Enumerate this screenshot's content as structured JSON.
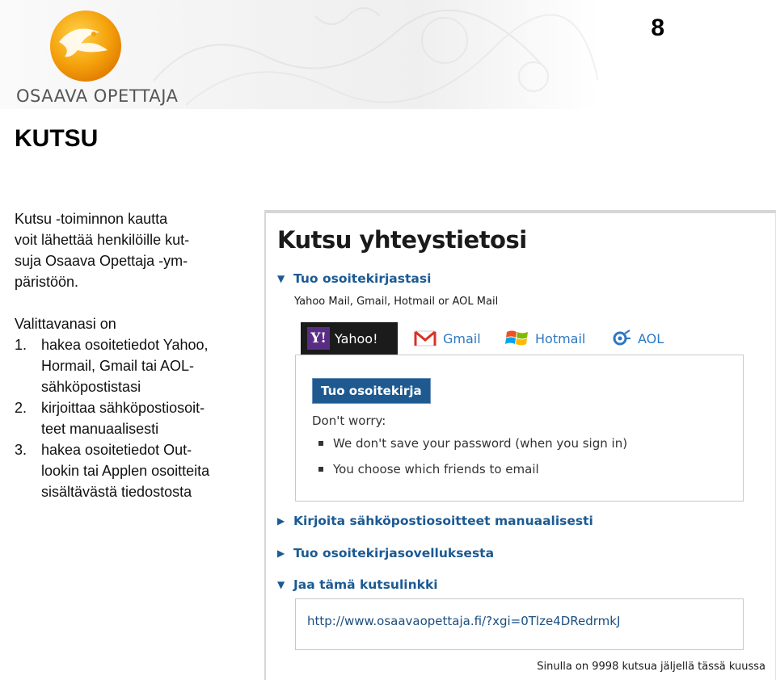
{
  "page_number": "8",
  "logo": {
    "text": "OSAAVA OPETTAJA"
  },
  "title": "KUTSU",
  "intro": {
    "lines": [
      "Kutsu -toiminnon kautta",
      "voit lähettää henkilöille kut-",
      "suja Osaava Opettaja -ym-",
      "päristöön."
    ],
    "choices_intro": "Valittavanasi on",
    "choices": [
      {
        "num": "1.",
        "lines": [
          "hakea osoitetiedot Yahoo,",
          "Hormail, Gmail tai AOL-",
          "sähköpostistasi"
        ]
      },
      {
        "num": "2.",
        "lines": [
          "kirjoittaa sähköpostiosoit-",
          "teet manuaalisesti"
        ]
      },
      {
        "num": "3.",
        "lines": [
          "hakea osoitetiedot Out-",
          "lookin tai Applen osoitteita",
          "sisältävästä tiedostosta"
        ]
      }
    ]
  },
  "screenshot": {
    "title": "Kutsu yhteystietosi",
    "sections": {
      "import": {
        "label": "Tuo osoitekirjastasi",
        "expanded_marker": "▼"
      },
      "manual": {
        "label": "Kirjoita sähköpostiosoitteet manuaalisesti",
        "collapsed_marker": "▶"
      },
      "apps": {
        "label": "Tuo osoitekirjasovelluksesta",
        "collapsed_marker": "▶"
      },
      "share": {
        "label": "Jaa tämä kutsulinkki",
        "expanded_marker": "▼"
      }
    },
    "providers_caption": "Yahoo Mail, Gmail, Hotmail or AOL Mail",
    "providers": [
      {
        "name": "Yahoo!",
        "icon": "yahoo-icon",
        "selected": true
      },
      {
        "name": "Gmail",
        "icon": "gmail-icon"
      },
      {
        "name": "Hotmail",
        "icon": "windows-flag-icon"
      },
      {
        "name": "AOL",
        "icon": "aol-icon"
      }
    ],
    "import_button": "Tuo osoitekirja",
    "dont_worry": "Don't worry:",
    "bullets": [
      "We don't save your password (when you sign in)",
      "You choose which friends to email"
    ],
    "invite_link": "http://www.osaavaopettaja.fi/?xgi=0Tlze4DRedrmkJ",
    "remaining_invites": "Sinulla on 9998 kutsua jäljellä tässä kuussa",
    "colors": {
      "link_blue": "#1b5a93",
      "button_blue": "#1e5a90",
      "yahoo_purple": "#5a2d85"
    }
  }
}
